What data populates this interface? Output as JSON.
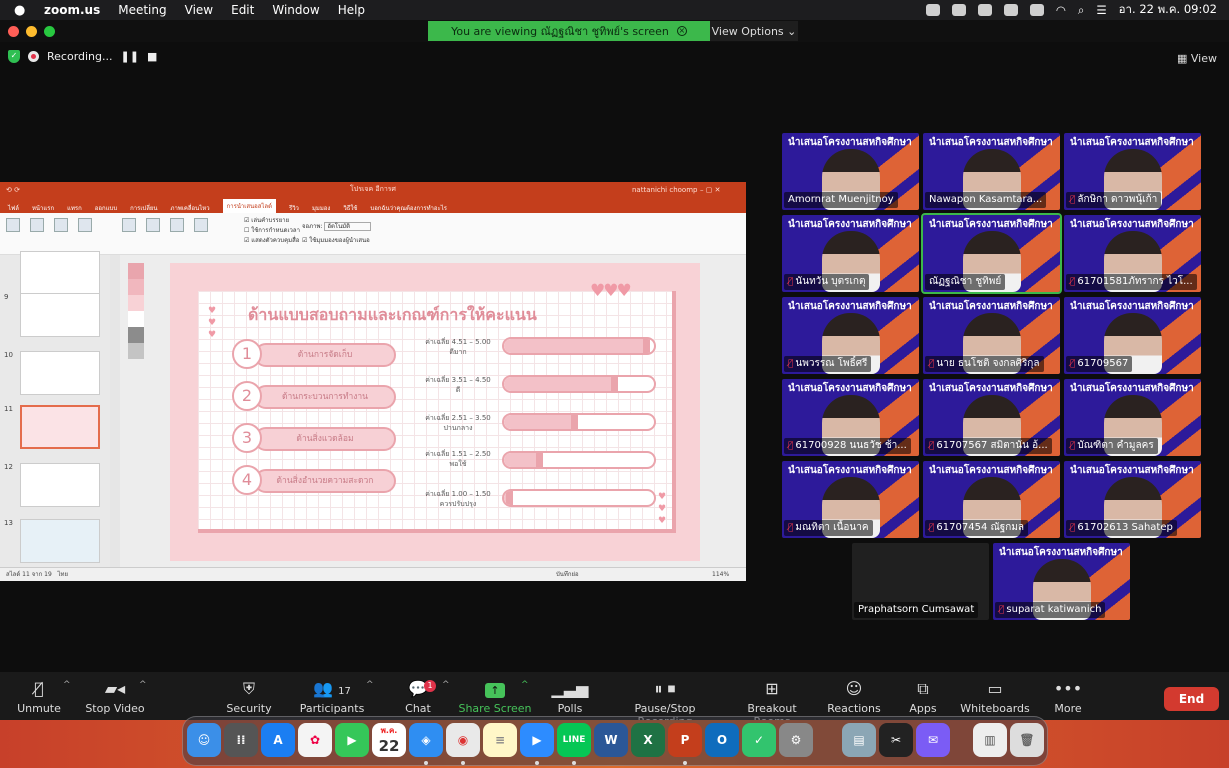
{
  "menubar": {
    "app": "zoom.us",
    "items": [
      "Meeting",
      "View",
      "Edit",
      "Window",
      "Help"
    ],
    "clock": "อา. 22 พ.ค.  09:02"
  },
  "window": {
    "viewing_banner": "You are viewing ณัฏฐณิชา ชูทิพย์'s screen",
    "view_options": "View Options",
    "recording_label": "Recording...",
    "view_button": "View"
  },
  "shared_screen": {
    "ppt_title": "โปรเจค อีการศ",
    "ppt_user": "nattanichi choomp",
    "ppt_tabs": [
      "ไฟล์",
      "หน้าแรก",
      "แทรก",
      "ออกแบบ",
      "การเปลี่ยน",
      "ภาพเคลื่อนไหว",
      "การนำเสนอสไลด์",
      "รีวิว",
      "มุมมอง",
      "วิธีใช้",
      "บอกฉันว่าคุณต้องการทำอะไร"
    ],
    "active_tab": "การนำเสนอสไลด์",
    "ribbon_checks": [
      "เล่นคำบรรยาย",
      "ใช้การกำหนดเวลา",
      "แสดงตัวควบคุมสื่อ"
    ],
    "ribbon_monitor_label": "จอภาพ:",
    "ribbon_monitor_value": "อัตโนมัติ",
    "ribbon_presenter": "ใช้มุมมองของผู้นำเสนอ",
    "thumb_numbers": [
      "9",
      "10",
      "11",
      "12",
      "13"
    ],
    "status_left": "สไลด์ 11 จาก 19",
    "status_lang": "ไทย",
    "status_notes": "บันทึกย่อ",
    "status_zoom": "114%",
    "slide": {
      "title": "ด้านแบบสอบถามและเกณฑ์การให้คะแนน",
      "categories": [
        {
          "num": "1",
          "label": "ด้านการจัดเก็บ"
        },
        {
          "num": "2",
          "label": "ด้านกระบวนการทำงาน"
        },
        {
          "num": "3",
          "label": "ด้านสิ่งแวดล้อม"
        },
        {
          "num": "4",
          "label": "ด้านสิ่งอำนวยความสะดวก"
        }
      ],
      "levels": [
        {
          "range": "ค่าเฉลี่ย 4.51 – 5.00",
          "label": "ดีมาก",
          "fill": 0.97
        },
        {
          "range": "ค่าเฉลี่ย 3.51 – 4.50",
          "label": "ดี",
          "fill": 0.76
        },
        {
          "range": "ค่าเฉลี่ย 2.51 – 3.50",
          "label": "ปานกลาง",
          "fill": 0.49
        },
        {
          "range": "ค่าเฉลี่ย 1.51 – 2.50",
          "label": "พอใช้",
          "fill": 0.26
        },
        {
          "range": "ค่าเฉลี่ย 1.00 – 1.50",
          "label": "ควรปรับปรุง",
          "fill": 0.06
        }
      ]
    }
  },
  "participants": [
    {
      "name": "Amornrat Muenjitnoy",
      "muted": false,
      "type": "video"
    },
    {
      "name": "Nawapon Kasamtara...",
      "muted": false,
      "type": "video"
    },
    {
      "name": "ลักษิกา ดาวพนุ้เก้า",
      "muted": true,
      "type": "video"
    },
    {
      "name": "นันทวัน บุตรเกตุ",
      "muted": true,
      "type": "video"
    },
    {
      "name": "ณัฏฐณิชา ชูทิพย์",
      "muted": false,
      "type": "video",
      "active": true
    },
    {
      "name": "61701581ภัทรากร ไวโ...",
      "muted": true,
      "type": "video"
    },
    {
      "name": "นพวรรณ โพธิ์ศรี",
      "muted": true,
      "type": "video"
    },
    {
      "name": "นาย ธนโชติ จงกลศิริกุล",
      "muted": true,
      "type": "video"
    },
    {
      "name": "61709567",
      "muted": true,
      "type": "video"
    },
    {
      "name": "61700928 นนธวัช ช้า...",
      "muted": true,
      "type": "video"
    },
    {
      "name": "61707567 สมิตานัน อ้...",
      "muted": true,
      "type": "video"
    },
    {
      "name": "บัณฑิตา คำมูลคร",
      "muted": true,
      "type": "video"
    },
    {
      "name": "มณทิตา เนื้อนาค",
      "muted": true,
      "type": "video"
    },
    {
      "name": "61707454 ณัฐกมล",
      "muted": true,
      "type": "video"
    },
    {
      "name": "61702613 Sahatep",
      "muted": true,
      "type": "video"
    },
    {
      "name": "Praphatsorn Cumsawat",
      "muted": false,
      "type": "dark"
    },
    {
      "name": "suparat katiwanich",
      "muted": true,
      "type": "video"
    }
  ],
  "tile_banner": "นำเสนอโครงงานสหกิจศึกษา",
  "toolbar": {
    "unmute": "Unmute",
    "stop_video": "Stop Video",
    "security": "Security",
    "participants": "Participants",
    "participants_count": "17",
    "chat": "Chat",
    "chat_badge": "1",
    "share_screen": "Share Screen",
    "polls": "Polls",
    "pause_recording": "Pause/Stop Recording",
    "breakout": "Breakout Rooms",
    "reactions": "Reactions",
    "apps": "Apps",
    "whiteboards": "Whiteboards",
    "more": "More",
    "end": "End"
  },
  "dock": {
    "calendar_month": "พ.ค.",
    "calendar_day": "22"
  },
  "colors": {
    "zoom_green": "#3cb84b",
    "end_red": "#d33a2f",
    "slide_pink": "#f8d2d6",
    "tile_blue": "#2d1a9a",
    "tile_orange": "#f26b2b"
  }
}
